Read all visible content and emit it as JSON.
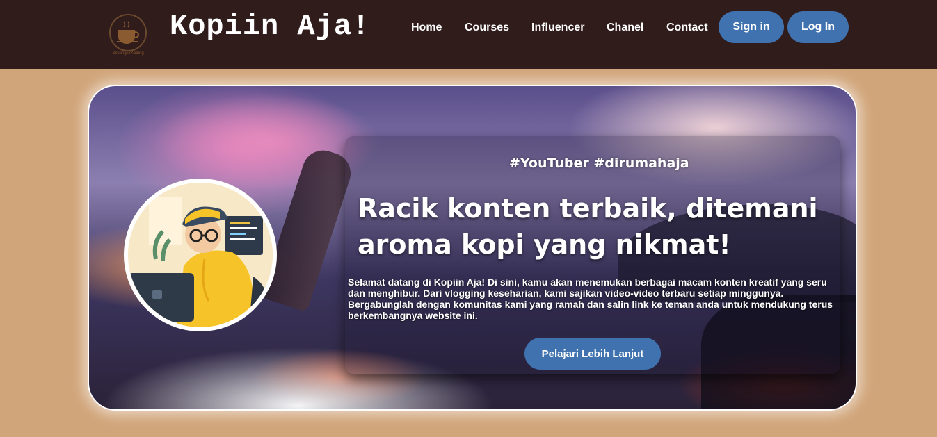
{
  "header": {
    "logo_caption": "SecangkirKoding",
    "brand": "Kopiin Aja!",
    "nav": [
      "Home",
      "Courses",
      "Influencer",
      "Chanel",
      "Contact"
    ],
    "sign_in": "Sign in",
    "log_in": "Log In"
  },
  "hero": {
    "tagline": "#YouTuber #dirumahaja",
    "headline": "Racik konten terbaik, ditemani aroma kopi yang nikmat!",
    "body": "Selamat datang di Kopiin Aja! Di sini, kamu akan menemukan berbagai macam konten kreatif yang seru dan menghibur. Dari vlogging keseharian, kami sajikan video-video terbaru setiap minggunya. Bergabunglah dengan komunitas kami yang ramah dan salin link ke teman anda untuk mendukung terus berkembangnya website ini.",
    "cta": "Pelajari Lebih Lanjut"
  },
  "colors": {
    "header_bg": "#311c1c",
    "page_bg": "#d1a57a",
    "button_bg": "#3f72af",
    "text": "#ffffff"
  }
}
